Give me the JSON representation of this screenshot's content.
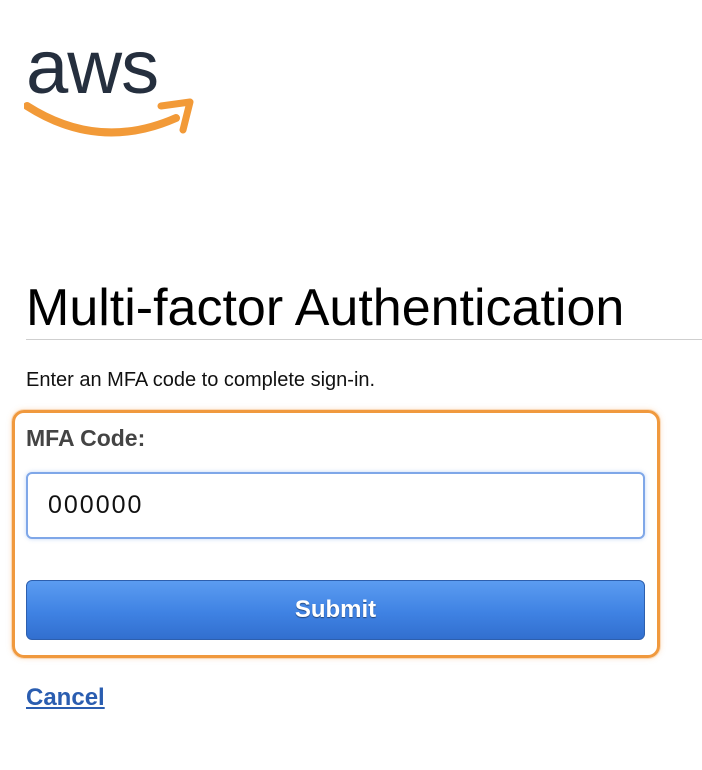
{
  "logo": {
    "text": "aws",
    "smile_color": "#f29a38",
    "text_color": "#252f3e"
  },
  "page_title": "Multi-factor Authentication",
  "instructions": "Enter an MFA code to complete sign-in.",
  "form": {
    "label": "MFA Code:",
    "code_value": "000000",
    "submit_label": "Submit",
    "cancel_label": "Cancel"
  },
  "colors": {
    "highlight_border": "#f0993e",
    "button_blue": "#3f82e3",
    "link_blue": "#2a5db0"
  }
}
